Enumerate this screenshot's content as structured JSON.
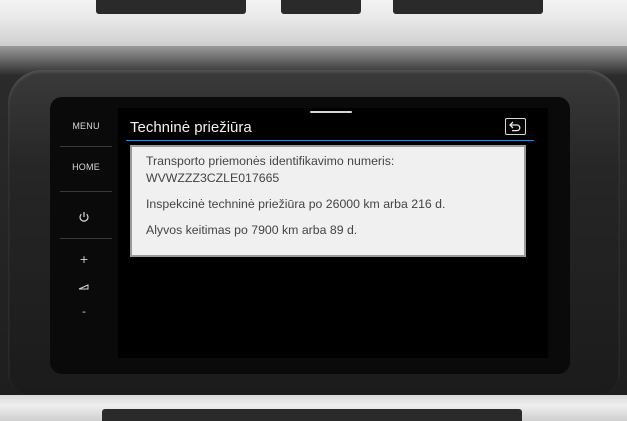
{
  "sidebar": {
    "menu_label": "MENU",
    "home_label": "HOME",
    "power_icon": "power-icon",
    "volume_up": "+",
    "volume_down": "-"
  },
  "screen": {
    "title": "Techninė priežiūra",
    "back_icon": "back-icon",
    "info": {
      "vin_label": "Transporto priemonės identifikavimo numeris:",
      "vin_value": "WVWZZZ3CZLE017665",
      "inspection": "Inspekcinė techninė priežiūra po 26000 km arba 216 d.",
      "oil_change": "Alyvos keitimas po 7900 km arba 89 d."
    }
  },
  "colors": {
    "accent_line": "#2f88c9",
    "panel_bg": "#f0f0f0",
    "screen_bg": "#000000"
  }
}
